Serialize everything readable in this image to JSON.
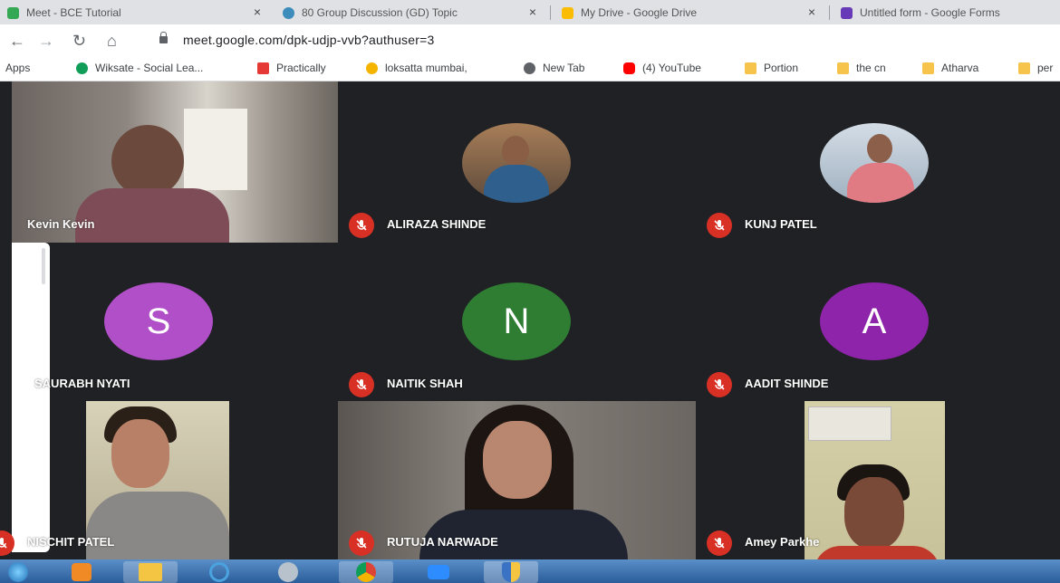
{
  "browser": {
    "tabs": [
      {
        "title": "Meet - BCE Tutorial",
        "color": "#34a853",
        "active": false
      },
      {
        "title": "80 Group Discussion (GD) Topic",
        "color": "#3c8dbc",
        "active": false
      },
      {
        "title": "My Drive - Google Drive",
        "color": "#fbbc04",
        "active": false
      },
      {
        "title": "Untitled form - Google Forms",
        "color": "#673ab7",
        "active": false
      }
    ],
    "close_glyph": "×",
    "url": "meet.google.com/dpk-udjp-vvb?authuser=3",
    "bookmarks": [
      {
        "label": "Apps",
        "icon": "apps-grid-icon",
        "color": "#5f6368"
      },
      {
        "label": "Wiksate - Social Lea...",
        "icon": "wiksate-icon",
        "color": "#0f9d58"
      },
      {
        "label": "Practically",
        "icon": "practically-icon",
        "color": "#e53935"
      },
      {
        "label": "loksatta mumbai,",
        "icon": "loksatta-icon",
        "color": "#f4b400"
      },
      {
        "label": "New Tab",
        "icon": "new-tab-icon",
        "color": "#5f6368"
      },
      {
        "label": "(4) YouTube",
        "icon": "youtube-icon",
        "color": "#ff0000"
      },
      {
        "label": "Portion",
        "icon": "folder-icon",
        "color": "#f6c34b"
      },
      {
        "label": "the cn",
        "icon": "folder-icon",
        "color": "#f6c34b"
      },
      {
        "label": "Atharva",
        "icon": "folder-icon",
        "color": "#f6c34b"
      },
      {
        "label": "per",
        "icon": "folder-icon",
        "color": "#f6c34b"
      }
    ]
  },
  "meet": {
    "participants": [
      {
        "name": "Kevin Kevin",
        "type": "video",
        "muted": false
      },
      {
        "name": "ALIRAZA SHINDE",
        "type": "photo",
        "muted": true
      },
      {
        "name": "KUNJ PATEL",
        "type": "photo",
        "muted": true
      },
      {
        "name": "SAURABH NYATI",
        "type": "letter",
        "letter": "S",
        "color": "#b04fc8",
        "muted": false
      },
      {
        "name": "NAITIK SHAH",
        "type": "letter",
        "letter": "N",
        "color": "#2e7d32",
        "muted": true
      },
      {
        "name": "AADIT SHINDE",
        "type": "letter",
        "letter": "A",
        "color": "#8e24aa",
        "muted": true
      },
      {
        "name": "NISCHIT PATEL",
        "type": "video",
        "muted": true
      },
      {
        "name": "RUTUJA NARWADE",
        "type": "video",
        "muted": true
      },
      {
        "name": "Amey Parkhe",
        "type": "video",
        "muted": true
      }
    ],
    "mute_color": "#d93025"
  }
}
